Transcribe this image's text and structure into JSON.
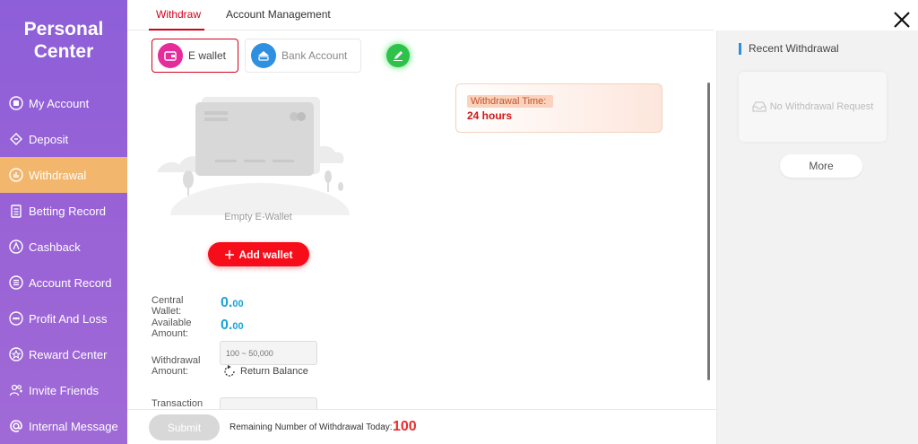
{
  "sidebar": {
    "brand_line1": "Personal",
    "brand_line2": "Center",
    "items": [
      {
        "label": "My Account",
        "icon": "account-icon"
      },
      {
        "label": "Deposit",
        "icon": "deposit-icon"
      },
      {
        "label": "Withdrawal",
        "icon": "withdrawal-icon",
        "active": true
      },
      {
        "label": "Betting Record",
        "icon": "clipboard-icon"
      },
      {
        "label": "Cashback",
        "icon": "cashback-icon"
      },
      {
        "label": "Account Record",
        "icon": "list-icon"
      },
      {
        "label": "Profit And Loss",
        "icon": "chart-icon"
      },
      {
        "label": "Reward Center",
        "icon": "star-icon"
      },
      {
        "label": "Invite Friends",
        "icon": "users-icon"
      },
      {
        "label": "Internal Message",
        "icon": "at-icon"
      }
    ]
  },
  "tabs": [
    {
      "label": "Withdraw",
      "active": true
    },
    {
      "label": "Account Management"
    }
  ],
  "methods": {
    "ewallet": "E wallet",
    "bank": "Bank Account"
  },
  "main": {
    "empty_text": "Empty E-Wallet",
    "add_wallet": "Add wallet",
    "central_wallet_label": "Central Wallet:",
    "central_wallet_int": "0.",
    "central_wallet_dec": "00",
    "available_label": "Available Amount:",
    "available_int": "0.",
    "available_dec": "00",
    "withdrawal_amount_label": "Withdrawal Amount:",
    "amount_placeholder": "100 ~ 50,000",
    "return_balance": "Return Balance",
    "transaction_label": "Transaction"
  },
  "notice": {
    "label": "Withdrawal Time:",
    "value": "24 hours"
  },
  "bottom": {
    "submit": "Submit",
    "remaining_label": "Remaining Number of Withdrawal Today:",
    "remaining_count": "100"
  },
  "right_panel": {
    "title": "Recent Withdrawal",
    "empty": "No Withdrawal Request",
    "more": "More"
  },
  "colors": {
    "sidebar": "#9a63d6",
    "active_nav": "#f2b66c",
    "accent_red": "#d0021b",
    "value_blue": "#1aa3d6"
  }
}
